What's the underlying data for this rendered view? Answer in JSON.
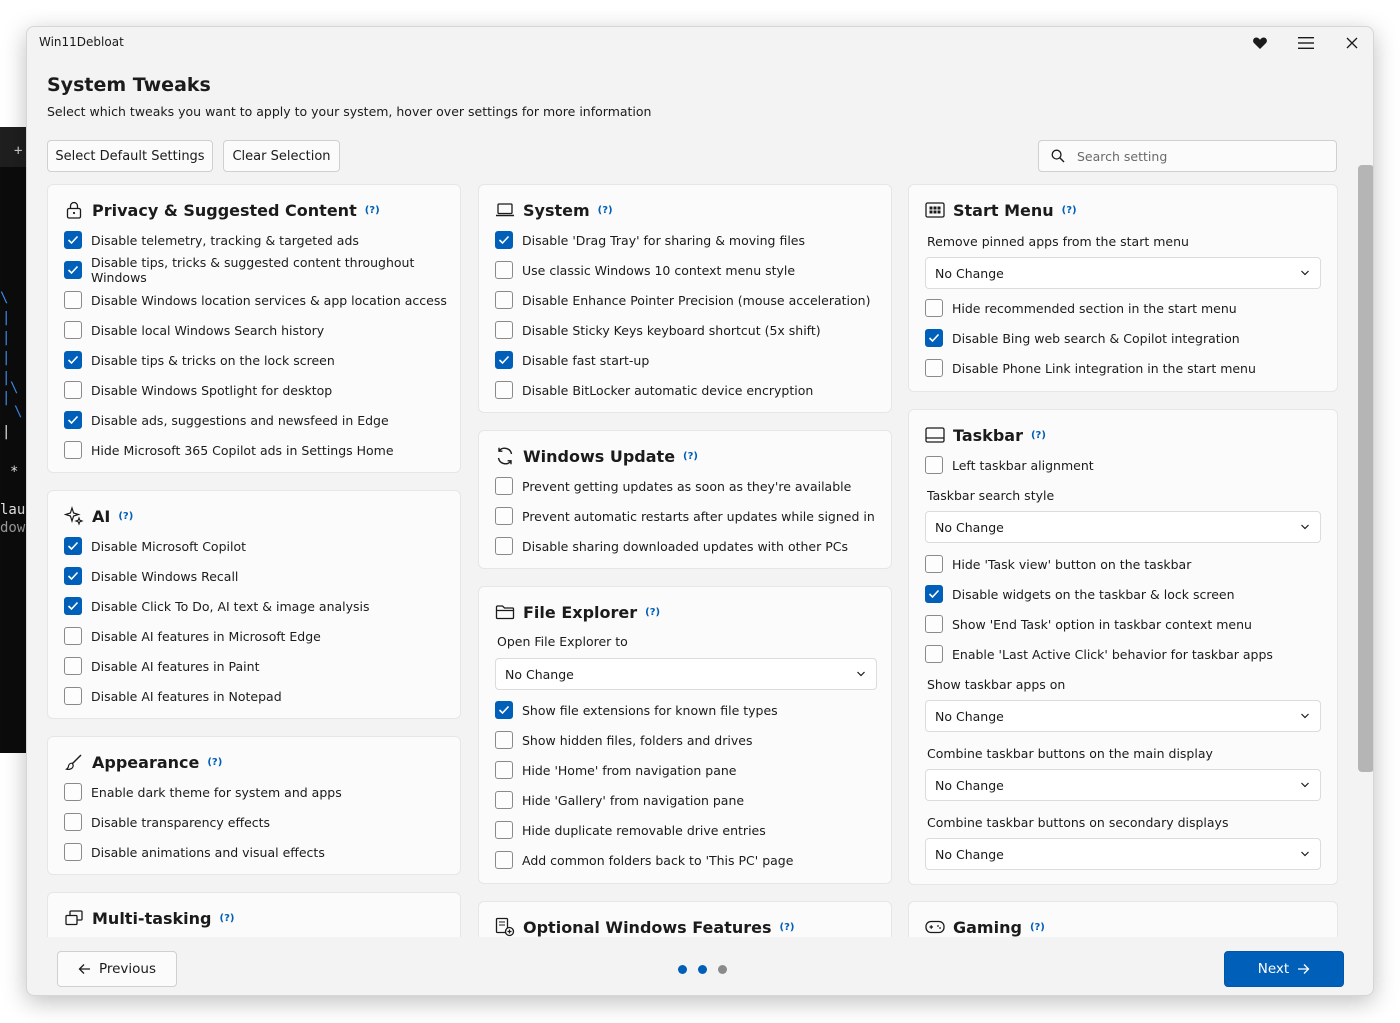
{
  "app": {
    "title": "Win11Debloat"
  },
  "terminal": {
    "tab_glyph": "+",
    "lines": [
      "\\",
      "|",
      "|",
      "|",
      "|",
      "\\",
      "|",
      "\\",
      "|",
      "*",
      "lau",
      "dow"
    ]
  },
  "header": {
    "title": "System Tweaks",
    "subtitle": "Select which tweaks you want to apply to your system, hover over settings for more information"
  },
  "toolbar": {
    "select_default_label": "Select Default Settings",
    "clear_label": "Clear Selection",
    "search_placeholder": "Search setting"
  },
  "help_glyph": "(?)",
  "privacy": {
    "title": "Privacy & Suggested Content",
    "items": [
      {
        "label": "Disable telemetry, tracking & targeted ads",
        "checked": true
      },
      {
        "label": "Disable tips, tricks & suggested content throughout Windows",
        "checked": true
      },
      {
        "label": "Disable Windows location services & app location access",
        "checked": false
      },
      {
        "label": "Disable local Windows Search history",
        "checked": false
      },
      {
        "label": "Disable tips & tricks on the lock screen",
        "checked": true
      },
      {
        "label": "Disable Windows Spotlight for desktop",
        "checked": false
      },
      {
        "label": "Disable ads, suggestions and newsfeed in Edge",
        "checked": true
      },
      {
        "label": "Hide Microsoft 365 Copilot ads in Settings Home",
        "checked": false
      }
    ]
  },
  "ai": {
    "title": "AI",
    "items": [
      {
        "label": "Disable Microsoft Copilot",
        "checked": true
      },
      {
        "label": "Disable Windows Recall",
        "checked": true
      },
      {
        "label": "Disable Click To Do, AI text & image analysis",
        "checked": true
      },
      {
        "label": "Disable AI features in Microsoft Edge",
        "checked": false
      },
      {
        "label": "Disable AI features in Paint",
        "checked": false
      },
      {
        "label": "Disable AI features in Notepad",
        "checked": false
      }
    ]
  },
  "appearance": {
    "title": "Appearance",
    "items": [
      {
        "label": "Enable dark theme for system and apps",
        "checked": false
      },
      {
        "label": "Disable transparency effects",
        "checked": false
      },
      {
        "label": "Disable animations and visual effects",
        "checked": false
      }
    ]
  },
  "multitasking": {
    "title": "Multi-tasking"
  },
  "system": {
    "title": "System",
    "items": [
      {
        "label": "Disable 'Drag Tray' for sharing & moving files",
        "checked": true
      },
      {
        "label": "Use classic Windows 10 context menu style",
        "checked": false
      },
      {
        "label": "Disable Enhance Pointer Precision (mouse acceleration)",
        "checked": false
      },
      {
        "label": "Disable Sticky Keys keyboard shortcut (5x shift)",
        "checked": false
      },
      {
        "label": "Disable fast start-up",
        "checked": true
      },
      {
        "label": "Disable BitLocker automatic device encryption",
        "checked": false
      }
    ]
  },
  "windows_update": {
    "title": "Windows Update",
    "items": [
      {
        "label": "Prevent getting updates as soon as they're available",
        "checked": false
      },
      {
        "label": "Prevent automatic restarts after updates while signed in",
        "checked": false
      },
      {
        "label": "Disable sharing downloaded updates with other PCs",
        "checked": false
      }
    ]
  },
  "file_explorer": {
    "title": "File Explorer",
    "open_label": "Open File Explorer to",
    "open_value": "No Change",
    "items": [
      {
        "label": "Show file extensions for known file types",
        "checked": true
      },
      {
        "label": "Show hidden files, folders and drives",
        "checked": false
      },
      {
        "label": "Hide 'Home' from navigation pane",
        "checked": false
      },
      {
        "label": "Hide 'Gallery' from navigation pane",
        "checked": false
      },
      {
        "label": "Hide duplicate removable drive entries",
        "checked": false
      },
      {
        "label": "Add common folders back to 'This PC' page",
        "checked": false
      }
    ]
  },
  "optional_features": {
    "title": "Optional Windows Features"
  },
  "start_menu": {
    "title": "Start Menu",
    "pinned_label": "Remove pinned apps from the start menu",
    "pinned_value": "No Change",
    "items": [
      {
        "label": "Hide recommended section in the start menu",
        "checked": false
      },
      {
        "label": "Disable Bing web search & Copilot integration",
        "checked": true
      },
      {
        "label": "Disable Phone Link integration in the start menu",
        "checked": false
      }
    ]
  },
  "taskbar": {
    "title": "Taskbar",
    "left_align": {
      "label": "Left taskbar alignment",
      "checked": false
    },
    "search_style_label": "Taskbar search style",
    "search_style_value": "No Change",
    "items": [
      {
        "label": "Hide 'Task view' button on the taskbar",
        "checked": false
      },
      {
        "label": "Disable widgets on the taskbar & lock screen",
        "checked": true
      },
      {
        "label": "Show 'End Task' option in taskbar context menu",
        "checked": false
      },
      {
        "label": "Enable 'Last Active Click' behavior for taskbar apps",
        "checked": false
      }
    ],
    "apps_on_label": "Show taskbar apps on",
    "apps_on_value": "No Change",
    "combine_main_label": "Combine taskbar buttons on the main display",
    "combine_main_value": "No Change",
    "combine_secondary_label": "Combine taskbar buttons on secondary displays",
    "combine_secondary_value": "No Change"
  },
  "gaming": {
    "title": "Gaming"
  },
  "footer": {
    "previous_label": "Previous",
    "next_label": "Next",
    "step_current": 2,
    "step_total": 3
  },
  "colors": {
    "accent": "#005fb8",
    "dot_active": "#005fb8",
    "dot_inactive": "#8a8a8a"
  }
}
